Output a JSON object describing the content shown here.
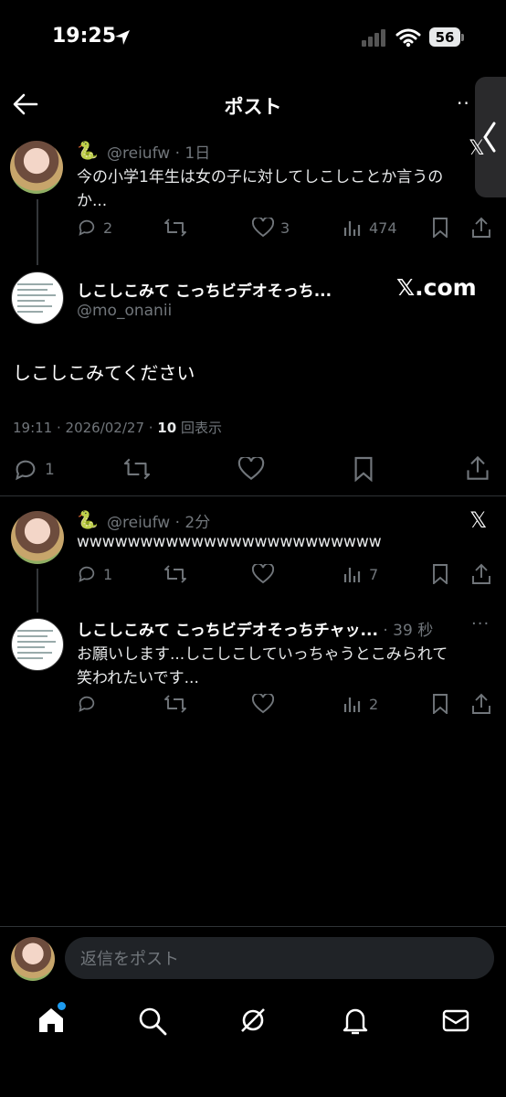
{
  "status": {
    "time": "19:25",
    "battery": "56"
  },
  "header": {
    "title": "ポスト"
  },
  "parent": {
    "handle": "@reiufw",
    "time": "1日",
    "text1": "今の小学1年生は女の子に対してしこしことか言うの",
    "text2": "か...",
    "replies": "2",
    "likes": "3",
    "views": "474"
  },
  "main": {
    "display_name": "しこしこみて こっちビデオそっち...",
    "handle": "@mo_onanii",
    "text": "しこしこみてください",
    "meta_time": "19:11 · 2026/02/27 · ",
    "views_count": "10",
    "views_label": "回表示",
    "replies": "1",
    "badge": "𝕏.com"
  },
  "reply1": {
    "handle": "@reiufw",
    "time": "2分",
    "text": "wwwwwwwwwwwwwwwwwwwwwwww",
    "replies": "1",
    "views": "7"
  },
  "reply2": {
    "display_name": "しこしこみて こっちビデオそっちチャッ...",
    "time": "39 秒",
    "text1": "お願いします...しこしこしていっちゃうとこみられて",
    "text2": "笑われたいです...",
    "views": "2"
  },
  "composer": {
    "placeholder": "返信をポスト"
  },
  "colors": {
    "background": "#000000",
    "text": "#e7e9ea",
    "muted": "#71767b",
    "accent": "#1d9bf0"
  },
  "icons": [
    "back-arrow-icon",
    "more-icon",
    "x-logo-icon",
    "reply-icon",
    "retweet-icon",
    "like-icon",
    "views-icon",
    "bookmark-icon",
    "share-icon",
    "home-icon",
    "search-icon",
    "grok-icon",
    "bell-icon",
    "mail-icon",
    "location-arrow-icon",
    "signal-icon",
    "wifi-icon"
  ]
}
